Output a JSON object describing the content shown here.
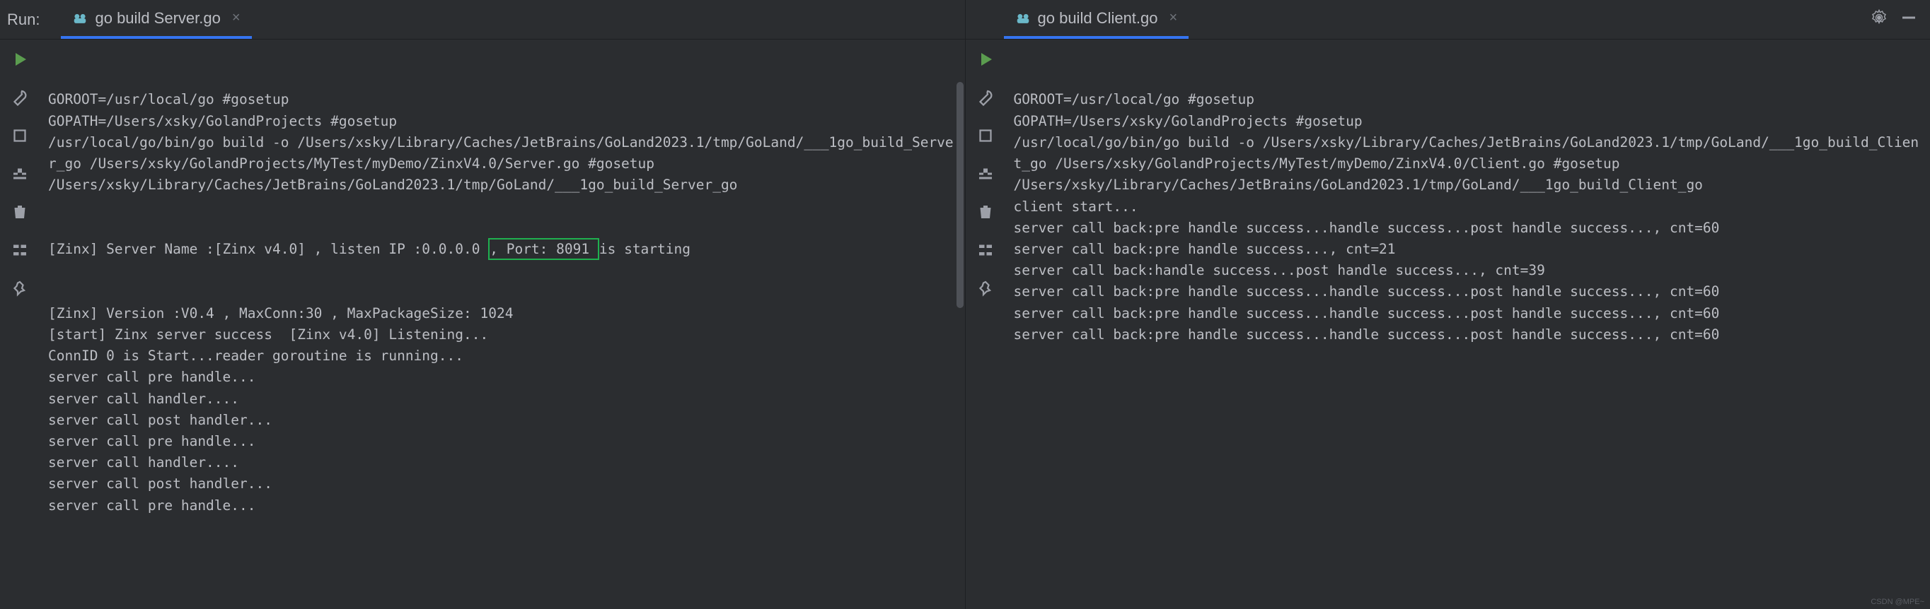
{
  "left": {
    "runLabel": "Run:",
    "tab": {
      "label": "go build Server.go"
    },
    "lines": [
      "GOROOT=/usr/local/go #gosetup",
      "GOPATH=/Users/xsky/GolandProjects #gosetup",
      "/usr/local/go/bin/go build -o /Users/xsky/Library/Caches/JetBrains/GoLand2023.1/tmp/GoLand/___1go_build_Server_go /Users/xsky/GolandProjects/MyTest/myDemo/ZinxV4.0/Server.go #gosetup",
      "/Users/xsky/Library/Caches/JetBrains/GoLand2023.1/tmp/GoLand/___1go_build_Server_go"
    ],
    "highlightLine": {
      "before": "[Zinx] Server Name :[Zinx v4.0] , listen IP :0.0.0.0 ",
      "highlight": ", Port: 8091 ",
      "after": "is starting"
    },
    "linesAfter": [
      "[Zinx] Version :V0.4 , MaxConn:30 , MaxPackageSize: 1024",
      "[start] Zinx server success  [Zinx v4.0] Listening...",
      "ConnID 0 is Start...reader goroutine is running...",
      "server call pre handle...",
      "server call handler....",
      "server call post handler...",
      "server call pre handle...",
      "server call handler....",
      "server call post handler...",
      "server call pre handle..."
    ]
  },
  "right": {
    "tab": {
      "label": "go build Client.go"
    },
    "lines": [
      "GOROOT=/usr/local/go #gosetup",
      "GOPATH=/Users/xsky/GolandProjects #gosetup",
      "/usr/local/go/bin/go build -o /Users/xsky/Library/Caches/JetBrains/GoLand2023.1/tmp/GoLand/___1go_build_Client_go /Users/xsky/GolandProjects/MyTest/myDemo/ZinxV4.0/Client.go #gosetup",
      "/Users/xsky/Library/Caches/JetBrains/GoLand2023.1/tmp/GoLand/___1go_build_Client_go",
      "client start...",
      "server call back:pre handle success...handle success...post handle success..., cnt=60",
      "server call back:pre handle success..., cnt=21",
      "server call back:handle success...post handle success..., cnt=39",
      "server call back:pre handle success...handle success...post handle success..., cnt=60",
      "server call back:pre handle success...handle success...post handle success..., cnt=60",
      "server call back:pre handle success...handle success...post handle success..., cnt=60"
    ]
  },
  "watermark": "CSDN @MPE~"
}
